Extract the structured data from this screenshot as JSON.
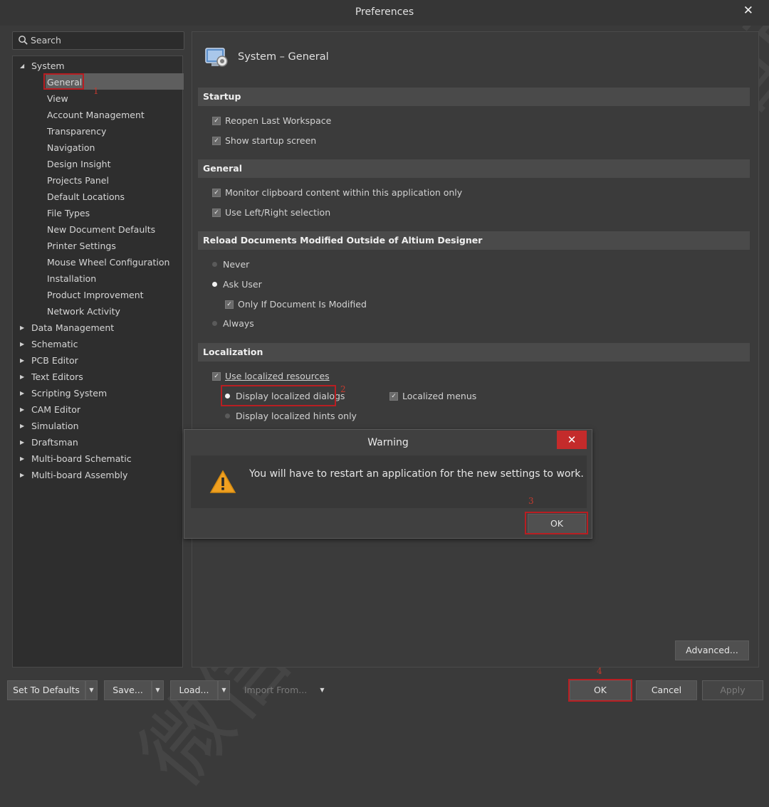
{
  "window": {
    "title": "Preferences",
    "close_glyph": "✕"
  },
  "search": {
    "placeholder": "Search",
    "icon": "search-icon"
  },
  "tree": {
    "root": "System",
    "system_children": [
      "General",
      "View",
      "Account Management",
      "Transparency",
      "Navigation",
      "Design Insight",
      "Projects Panel",
      "Default Locations",
      "File Types",
      "New Document Defaults",
      "Printer Settings",
      "Mouse Wheel Configuration",
      "Installation",
      "Product Improvement",
      "Network Activity"
    ],
    "selected": "General",
    "collapsed": [
      "Data Management",
      "Schematic",
      "PCB Editor",
      "Text Editors",
      "Scripting System",
      "CAM Editor",
      "Simulation",
      "Draftsman",
      "Multi-board Schematic",
      "Multi-board Assembly"
    ]
  },
  "page": {
    "title": "System – General",
    "icon": "system-general-icon"
  },
  "sections": {
    "startup": {
      "title": "Startup",
      "reopen": {
        "label": "Reopen Last Workspace",
        "checked": true
      },
      "splash": {
        "label": "Show startup screen",
        "checked": true
      }
    },
    "general": {
      "title": "General",
      "clipboard": {
        "label": "Monitor clipboard content within this application only",
        "checked": true
      },
      "leftright": {
        "label": "Use Left/Right selection",
        "checked": true
      }
    },
    "reload": {
      "title": "Reload Documents Modified Outside of Altium Designer",
      "never": {
        "label": "Never",
        "selected": false
      },
      "ask": {
        "label": "Ask User",
        "selected": true
      },
      "only_modified": {
        "label": "Only If Document Is Modified",
        "checked": true
      },
      "always": {
        "label": "Always",
        "selected": false
      }
    },
    "localization": {
      "title": "Localization",
      "use_localized": {
        "label": "Use localized resources",
        "checked": true
      },
      "dialogs": {
        "label": "Display localized dialogs",
        "selected": true
      },
      "menus": {
        "label": "Localized menus",
        "checked": true
      },
      "hints": {
        "label": "Display localized hints only",
        "selected": false
      }
    }
  },
  "warning": {
    "title": "Warning",
    "message": "You will have to restart an application for the new settings to work.",
    "ok_label": "OK",
    "close_glyph": "✕",
    "icon": "warning-icon"
  },
  "buttons": {
    "advanced": "Advanced...",
    "set_defaults": "Set To Defaults",
    "save": "Save...",
    "load": "Load...",
    "import": "Import From...",
    "ok": "OK",
    "cancel": "Cancel",
    "apply": "Apply"
  },
  "annotations": [
    "1",
    "2",
    "3",
    "4"
  ],
  "watermark": "微信公众号：安装软件指南",
  "colors": {
    "highlight": "#b81e22",
    "close_red": "#c42b2b"
  }
}
